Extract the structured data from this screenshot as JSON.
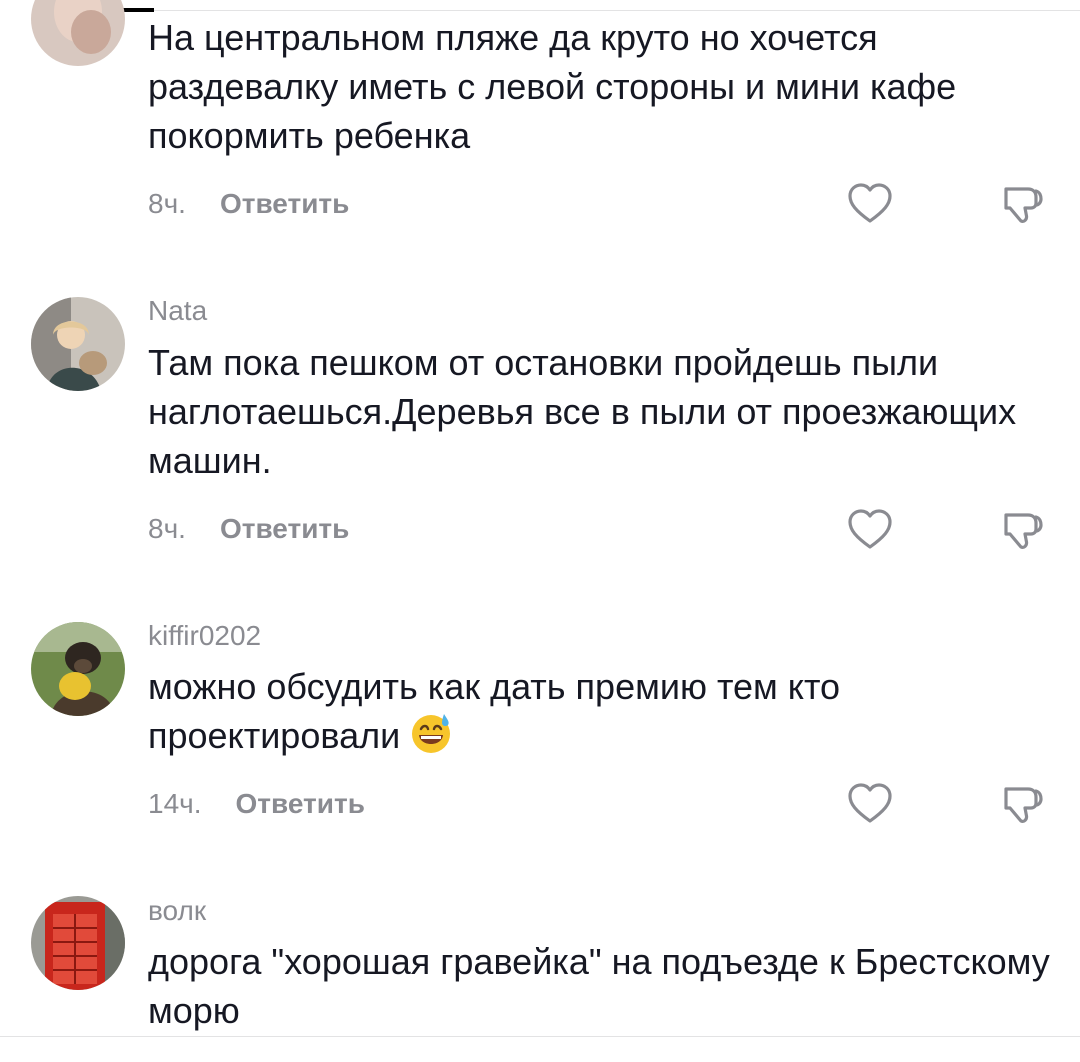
{
  "comments": [
    {
      "username": "",
      "text": "На центральном пляже да круто но хочется раздевалку иметь с левой стороны и мини кафе покормить ребенка",
      "time": "8ч.",
      "reply_label": "Ответить",
      "avatar_icon": "user-photo-avatar"
    },
    {
      "username": "Nata",
      "text": "Там пока пешком от остановки пройдешь пыли наглотаешься.Деревья все в пыли от проезжающих машин.",
      "time": "8ч.",
      "reply_label": "Ответить",
      "avatar_icon": "woman-with-cat-avatar"
    },
    {
      "username": "kiffir0202",
      "text": "можно обсудить как дать премию тем кто проектировали",
      "emoji": "grinning-face-with-sweat-emoji",
      "time": "14ч.",
      "reply_label": "Ответить",
      "avatar_icon": "puppy-with-toy-avatar"
    },
    {
      "username": "волк",
      "text": "дорога \"хорошая гравейка\" на подъезде к Брестскому морю",
      "time": "",
      "reply_label": "",
      "avatar_icon": "red-phone-booth-avatar"
    }
  ],
  "icons": {
    "like": "heart-outline-icon",
    "dislike": "thumbs-down-outline-icon"
  },
  "colors": {
    "text_primary": "#161823",
    "text_secondary": "#8a8b91",
    "background": "#ffffff"
  }
}
